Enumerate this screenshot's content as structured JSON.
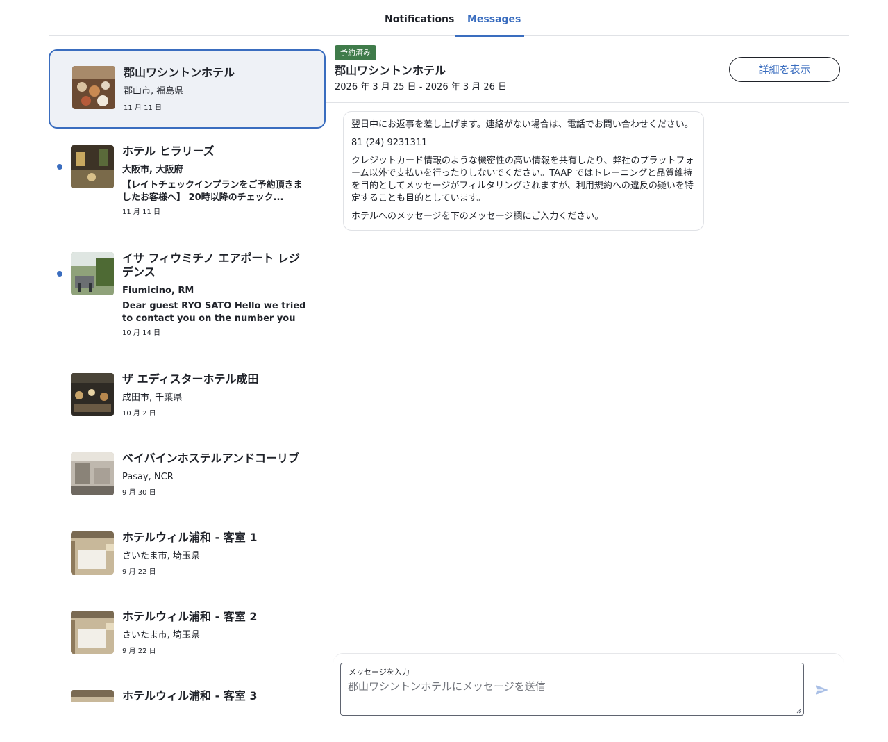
{
  "tabs": [
    {
      "label": "Notifications"
    },
    {
      "label": "Messages"
    }
  ],
  "conversations": [
    {
      "title": "郡山ワシントンホテル",
      "location": "郡山市, 福島県",
      "preview": "",
      "date": "11 月 11 日"
    },
    {
      "title": "ホテル ヒラリーズ",
      "location": "大阪市, 大阪府",
      "preview": "【レイトチェックインプランをご予約頂きましたお客様へ】 20時以降のチェック...",
      "date": "11 月 11 日"
    },
    {
      "title": "イサ フィウミチノ エアポート レジデンス",
      "location": "Fiumicino, RM",
      "preview": "Dear guest RYO SATO Hello we tried to contact you on the number you provid...",
      "date": "10 月 14 日"
    },
    {
      "title": "ザ エディスターホテル成田",
      "location": "成田市, 千葉県",
      "preview": "",
      "date": "10 月 2 日"
    },
    {
      "title": "ベイバインホステルアンドコーリブ",
      "location": "Pasay, NCR",
      "preview": "",
      "date": "9 月 30 日"
    },
    {
      "title": "ホテルウィル浦和 - 客室 1",
      "location": "さいたま市, 埼玉県",
      "preview": "",
      "date": "9 月 22 日"
    },
    {
      "title": "ホテルウィル浦和 - 客室 2",
      "location": "さいたま市, 埼玉県",
      "preview": "",
      "date": "9 月 22 日"
    },
    {
      "title": "ホテルウィル浦和 - 客室 3",
      "location": "",
      "preview": "",
      "date": ""
    }
  ],
  "detail": {
    "badge": "予約済み",
    "hotel_name": "郡山ワシントンホテル",
    "dates": "2026 年 3 月 25 日 - 2026 年 3 月 26 日",
    "details_button": "詳細を表示"
  },
  "message": {
    "paragraphs": [
      "翌日中にお返事を差し上げます。連絡がない場合は、電話でお問い合わせください。",
      "81 (24) 9231311",
      "クレジットカード情報のような機密性の高い情報を共有したり、弊社のプラットフォーム以外で支払いを行ったりしないでください。TAAP ではトレーニングと品質維持を目的としてメッセージがフィルタリングされますが、利用規約への違反の疑いを特定することも目的としています。",
      "ホテルへのメッセージを下のメッセージ欄にご入力ください。"
    ]
  },
  "composer": {
    "label": "メッセージを入力",
    "placeholder": "郡山ワシントンホテルにメッセージを送信"
  },
  "icons": {
    "send": "send-icon"
  },
  "colors": {
    "accent": "#3a6dbf",
    "badge": "#3f7b4a",
    "selected_bg": "#eef1f6"
  }
}
